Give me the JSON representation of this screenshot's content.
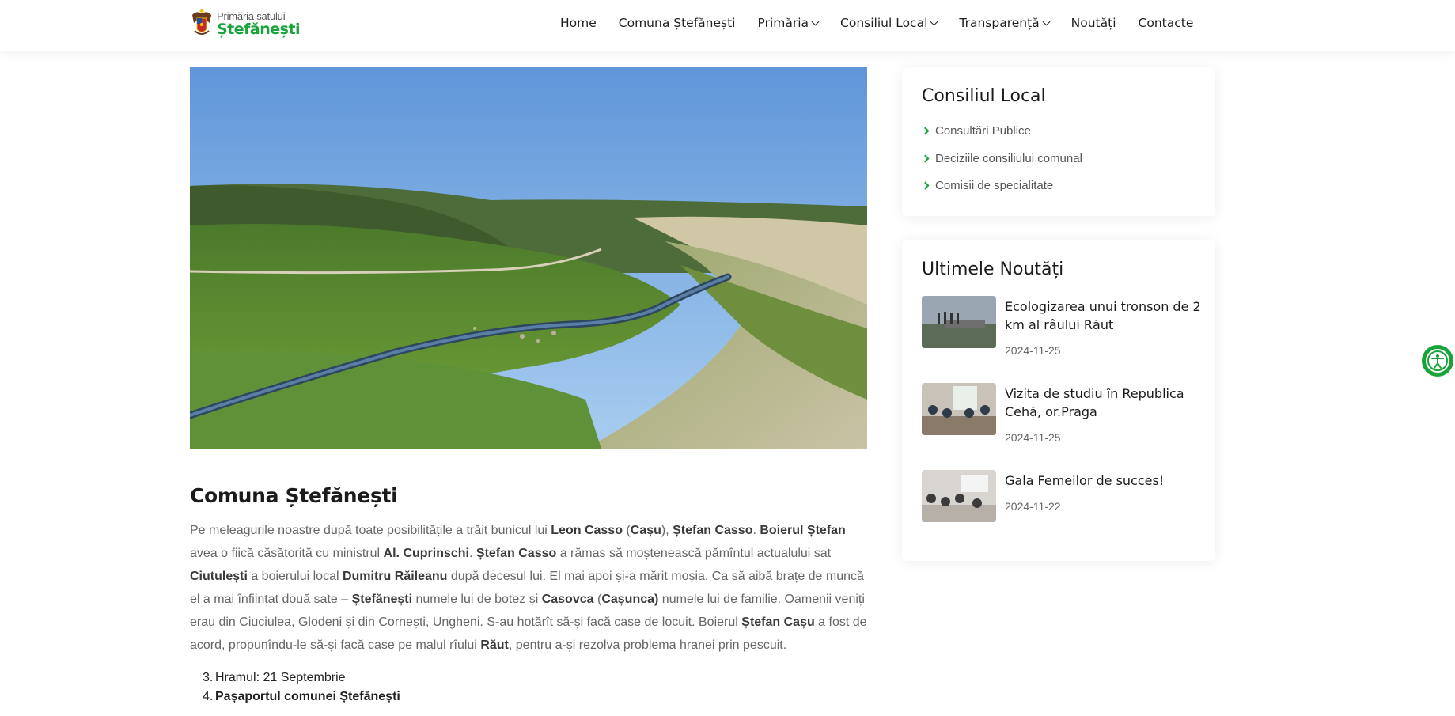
{
  "header": {
    "logo": {
      "line1": "Primăria satului",
      "line2": "Ștefănești"
    },
    "nav": [
      {
        "label": "Home",
        "dropdown": false
      },
      {
        "label": "Comuna Ștefănești",
        "dropdown": false
      },
      {
        "label": "Primăria",
        "dropdown": true
      },
      {
        "label": "Consiliul Local",
        "dropdown": true
      },
      {
        "label": "Transparență",
        "dropdown": true
      },
      {
        "label": "Noutăți",
        "dropdown": false
      },
      {
        "label": "Contacte",
        "dropdown": false
      }
    ]
  },
  "article": {
    "title": "Comuna Ștefănești",
    "paragraph": [
      {
        "t": "Pe meleagurile noastre după toate posibilitățile a trăit bunicul lui ",
        "b": false
      },
      {
        "t": "Leon Casso",
        "b": true
      },
      {
        "t": " (",
        "b": false
      },
      {
        "t": "Cașu",
        "b": true
      },
      {
        "t": "), ",
        "b": false
      },
      {
        "t": "Ștefan Casso",
        "b": true
      },
      {
        "t": ". ",
        "b": false
      },
      {
        "t": "Boierul Ștefan",
        "b": true
      },
      {
        "t": " avea o fiică căsătorită cu ministrul ",
        "b": false
      },
      {
        "t": "Al. Cuprinschi",
        "b": true
      },
      {
        "t": ". ",
        "b": false
      },
      {
        "t": "Ștefan Casso",
        "b": true
      },
      {
        "t": " a rămas să moștenească pămîntul actualului sat ",
        "b": false
      },
      {
        "t": "Ciutulești",
        "b": true
      },
      {
        "t": " a boierului local ",
        "b": false
      },
      {
        "t": "Dumitru Răileanu",
        "b": true
      },
      {
        "t": " după decesul lui. El mai apoi și-a mărit moșia. Ca să aibă brațe de muncă el a mai înființat două sate – ",
        "b": false
      },
      {
        "t": "Ștefănești",
        "b": true
      },
      {
        "t": " numele lui de botez și ",
        "b": false
      },
      {
        "t": "Casovca",
        "b": true
      },
      {
        "t": " (",
        "b": false
      },
      {
        "t": "Cașunca)",
        "b": true
      },
      {
        "t": " numele lui de familie. Oamenii veniți erau din Ciuciulea, Glodeni și din Cornești, Ungheni. S-au hotărît să-și facă case de locuit. Boierul ",
        "b": false
      },
      {
        "t": "Ștefan Cașu",
        "b": true
      },
      {
        "t": " a fost de acord, propunîndu-le să-și facă case pe malul rîului ",
        "b": false
      },
      {
        "t": "Răut",
        "b": true
      },
      {
        "t": ", pentru a-și rezolva problema hranei prin pescuit.",
        "b": false
      }
    ],
    "list": [
      {
        "num": "3.",
        "text": "Hramul: 21 Septembrie",
        "bold": false
      },
      {
        "num": "4.",
        "text": "Pașaportul comunei Ștefănești",
        "bold": true
      }
    ]
  },
  "sidebar": {
    "council": {
      "title": "Consiliul Local",
      "links": [
        "Consultări Publice",
        "Deciziile consiliului comunal",
        "Comisii de specialitate"
      ]
    },
    "news": {
      "title": "Ultimele Noutăți",
      "items": [
        {
          "title": "Ecologizarea unui tronson de 2 km al râului Răut",
          "date": "2024-11-25"
        },
        {
          "title": "Vizita de studiu în Republica Cehă, or.Praga",
          "date": "2024-11-25"
        },
        {
          "title": "Gala Femeilor de succes!",
          "date": "2024-11-22"
        }
      ]
    }
  },
  "colors": {
    "brand_green": "#19a33b",
    "text_dark": "#1b1b1b",
    "text_body": "#666666"
  },
  "icons": {
    "accessibility": "accessibility-icon",
    "sidebar_arrow": "chevron-right-icon",
    "dropdown": "chevron-down-icon"
  }
}
